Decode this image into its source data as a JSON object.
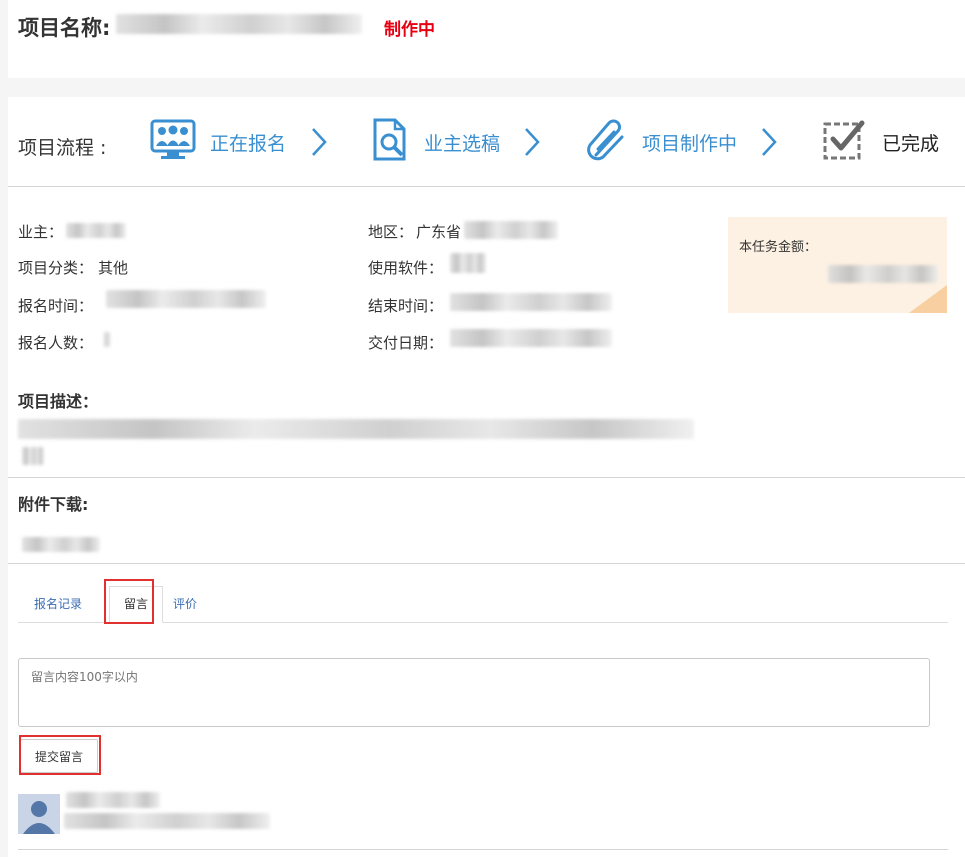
{
  "header": {
    "title_label": "项目名称:",
    "status": "制作中"
  },
  "flow": {
    "label": "项目流程 :",
    "steps": [
      {
        "label": "正在报名",
        "icon": "signup-users-icon"
      },
      {
        "label": "业主选稿",
        "icon": "document-search-icon"
      },
      {
        "label": "项目制作中",
        "icon": "paperclip-icon"
      },
      {
        "label": "已完成",
        "icon": "checkbox-checked-icon"
      }
    ]
  },
  "info": {
    "owner_label": "业主：",
    "category_label": "项目分类：",
    "category_value": "其他",
    "signup_time_label": "报名时间：",
    "signup_count_label": "报名人数：",
    "region_label": "地区：",
    "region_value": "广东省",
    "software_label": "使用软件：",
    "end_time_label": "结束时间：",
    "delivery_date_label": "交付日期："
  },
  "amount": {
    "label": "本任务金额："
  },
  "description": {
    "label": "项目描述："
  },
  "attachments": {
    "label": "附件下载:"
  },
  "tabs": [
    {
      "label": "报名记录"
    },
    {
      "label": "留言"
    },
    {
      "label": "评价"
    }
  ],
  "message": {
    "placeholder": "留言内容100字以内",
    "submit_label": "提交留言"
  },
  "colors": {
    "accent_blue": "#3a8fd1",
    "status_red": "#e60012",
    "highlight_red": "#e03030",
    "amount_bg": "#fdf1e3"
  }
}
